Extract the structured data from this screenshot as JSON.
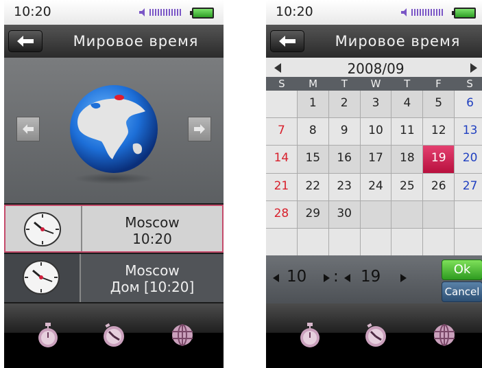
{
  "left_screen": {
    "status": {
      "time": "10:20"
    },
    "title": "Мировое время",
    "clocks": [
      {
        "city": "Moscow",
        "time": "10:20"
      },
      {
        "city": "Moscow",
        "time": "Дом [10:20]"
      }
    ],
    "toolbar": [
      "stopwatch-icon",
      "timer-icon",
      "world-clock-icon"
    ]
  },
  "right_screen": {
    "status": {
      "time": "10:20"
    },
    "title": "Мировое время",
    "calendar": {
      "month": "2008/09",
      "days_of_week": [
        "S",
        "M",
        "T",
        "W",
        "T",
        "F",
        "S"
      ],
      "rows": [
        [
          "",
          "1",
          "2",
          "3",
          "4",
          "5",
          "6"
        ],
        [
          "7",
          "8",
          "9",
          "10",
          "11",
          "12",
          "13"
        ],
        [
          "14",
          "15",
          "16",
          "17",
          "18",
          "19",
          "20"
        ],
        [
          "21",
          "22",
          "23",
          "24",
          "25",
          "26",
          "27"
        ],
        [
          "28",
          "29",
          "30",
          "",
          "",
          "",
          ""
        ],
        [
          "",
          "",
          "",
          "",
          "",
          "",
          ""
        ]
      ],
      "selected_day": "19"
    },
    "time_picker": {
      "hour": "10",
      "separator": ":",
      "minute": "19"
    },
    "ok_label": "Ok",
    "cancel_label": "Cancel",
    "toolbar": [
      "stopwatch-icon",
      "timer-icon",
      "world-clock-icon"
    ]
  },
  "colors": {
    "sunday": "#d8202c",
    "saturday": "#2040c0",
    "selected": "#c8204e",
    "ok": "#3fae2c"
  }
}
